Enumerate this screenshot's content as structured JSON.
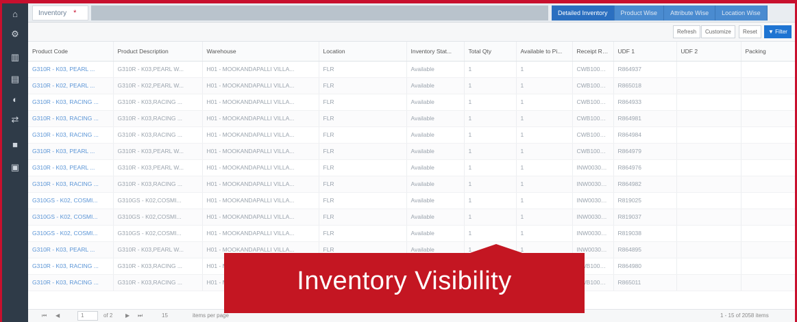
{
  "sidebar": {
    "icons": [
      "dashboard-icon",
      "settings-icon",
      "chart-icon",
      "reports-icon",
      "users-icon",
      "transfer-icon",
      "book-icon",
      "document-icon"
    ]
  },
  "topbar": {
    "active_tab": "Inventory",
    "view_tabs": [
      "Detailed Inventory",
      "Product Wise",
      "Attribute Wise",
      "Location Wise"
    ]
  },
  "toolbar": {
    "refresh": "Refresh",
    "customize": "Customize",
    "reset": "Reset",
    "filter": "Filter"
  },
  "table": {
    "columns": [
      "Product Code",
      "Product Description",
      "Warehouse",
      "Location",
      "Inventory Stat...",
      "Total Qty",
      "Available to Pi...",
      "Receipt Refer...",
      "UDF 1",
      "UDF 2",
      "Packing"
    ],
    "rows": [
      [
        "G310R - K03, PEARL ...",
        "G310R - K03,PEARL W...",
        "H01 - MOOKANDAPALLI VILLA...",
        "FLR",
        "Available",
        "1",
        "1",
        "CWB100001/...",
        "R864937",
        "",
        ""
      ],
      [
        "G310R - K02, PEARL ...",
        "G310R - K02,PEARL W...",
        "H01 - MOOKANDAPALLI VILLA...",
        "FLR",
        "Available",
        "1",
        "1",
        "CWB100001/...",
        "R865018",
        "",
        ""
      ],
      [
        "G310R - K03, RACING ...",
        "G310R - K03,RACING ...",
        "H01 - MOOKANDAPALLI VILLA...",
        "FLR",
        "Available",
        "1",
        "1",
        "CWB100001/...",
        "R864933",
        "",
        ""
      ],
      [
        "G310R - K03, RACING ...",
        "G310R - K03,RACING ...",
        "H01 - MOOKANDAPALLI VILLA...",
        "FLR",
        "Available",
        "1",
        "1",
        "CWB100001/...",
        "R864981",
        "",
        ""
      ],
      [
        "G310R - K03, RACING ...",
        "G310R - K03,RACING ...",
        "H01 - MOOKANDAPALLI VILLA...",
        "FLR",
        "Available",
        "1",
        "1",
        "CWB100001/...",
        "R864984",
        "",
        ""
      ],
      [
        "G310R - K03, PEARL ...",
        "G310R - K03,PEARL W...",
        "H01 - MOOKANDAPALLI VILLA...",
        "FLR",
        "Available",
        "1",
        "1",
        "CWB100001/...",
        "R864979",
        "",
        ""
      ],
      [
        "G310R - K03, PEARL ...",
        "G310R - K03,PEARL W...",
        "H01 - MOOKANDAPALLI VILLA...",
        "FLR",
        "Available",
        "1",
        "1",
        "INW00307440",
        "R864976",
        "",
        ""
      ],
      [
        "G310R - K03, RACING ...",
        "G310R - K03,RACING ...",
        "H01 - MOOKANDAPALLI VILLA...",
        "FLR",
        "Available",
        "1",
        "1",
        "INW00307440",
        "R864982",
        "",
        ""
      ],
      [
        "G310GS - K02, COSMI...",
        "G310GS - K02,COSMI...",
        "H01 - MOOKANDAPALLI VILLA...",
        "FLR",
        "Available",
        "1",
        "1",
        "INW00307440",
        "R819025",
        "",
        ""
      ],
      [
        "G310GS - K02, COSMI...",
        "G310GS - K02,COSMI...",
        "H01 - MOOKANDAPALLI VILLA...",
        "FLR",
        "Available",
        "1",
        "1",
        "INW00307440",
        "R819037",
        "",
        ""
      ],
      [
        "G310GS - K02, COSMI...",
        "G310GS - K02,COSMI...",
        "H01 - MOOKANDAPALLI VILLA...",
        "FLR",
        "Available",
        "1",
        "1",
        "INW00307440",
        "R819038",
        "",
        ""
      ],
      [
        "G310R - K03, PEARL ...",
        "G310R - K03,PEARL W...",
        "H01 - MOOKANDAPALLI VILLA...",
        "FLR",
        "Available",
        "1",
        "1",
        "INW00307440",
        "R864895",
        "",
        ""
      ],
      [
        "G310R - K03, RACING ...",
        "G310R - K03,RACING ...",
        "H01 - MOOKANDAPALLI VILLA...",
        "FLR",
        "Available",
        "1",
        "1",
        "CWB100011...",
        "R864980",
        "",
        ""
      ],
      [
        "G310R - K03, RACING ...",
        "G310R - K03,RACING ...",
        "H01 - MOOKANDAPALLI VILLA...",
        "FLR",
        "Available",
        "1",
        "1",
        "CWB100011...",
        "R865011",
        "",
        ""
      ]
    ]
  },
  "pager": {
    "first": "⏮",
    "prev": "◀",
    "page": "1",
    "of_pages": "of 2",
    "next": "▶",
    "last": "⏭",
    "page_size": "15",
    "items_per_page": "items per page",
    "summary": "1 - 15 of 2058 items"
  },
  "banner": {
    "title": "Inventory Visibility"
  },
  "colors": {
    "brand_red": "#c41622",
    "sidebar": "#2f3b48",
    "accent_blue": "#2b6fc0"
  }
}
